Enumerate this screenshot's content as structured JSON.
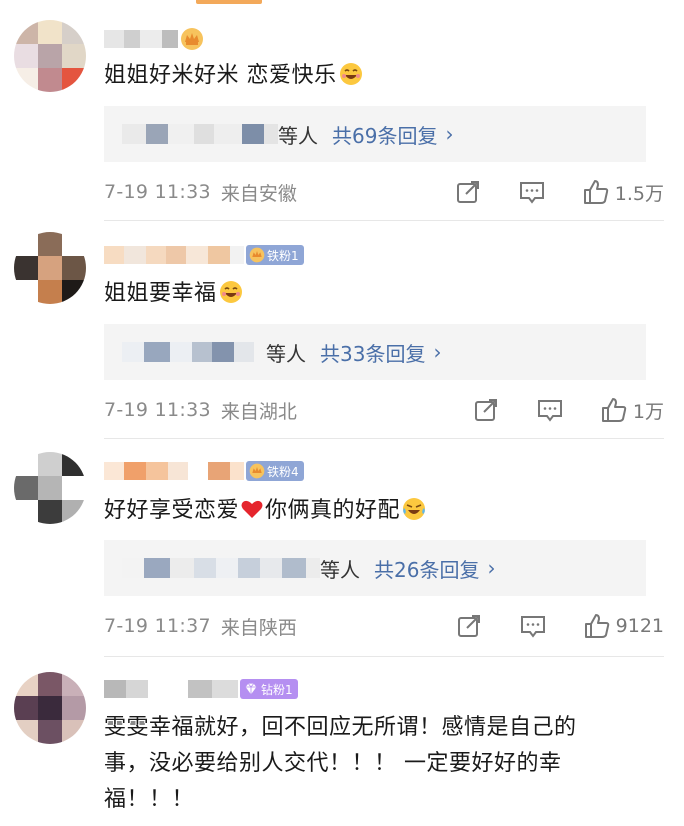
{
  "comments": [
    {
      "text": "姐姐好米好米 恋爱快乐",
      "emoji": "laughing-face-icon",
      "reply_suffix": "等人",
      "reply_link": "共69条回复",
      "date": "7-19 11:33",
      "location": "来自安徽",
      "likes": "1.5万",
      "badge": null
    },
    {
      "text": "姐姐要幸福",
      "emoji": "laughing-face-icon",
      "reply_suffix": "等人",
      "reply_link": "共33条回复",
      "date": "7-19 11:33",
      "location": "来自湖北",
      "likes": "1万",
      "badge": "铁粉1"
    },
    {
      "text": "好好享受恋爱",
      "text2": "你俩真的好配",
      "emoji": "crying-laughing-icon",
      "reply_suffix": "等人",
      "reply_link": "共26条回复",
      "date": "7-19 11:37",
      "location": "来自陕西",
      "likes": "9121",
      "badge": "铁粉4"
    },
    {
      "text_lines": [
        "雯雯幸福就好，回不回应无所谓！感情是自己的",
        "事，没必要给别人交代！！！ 一定要好好的幸",
        "福！！！"
      ],
      "badge": "钻粉1"
    }
  ],
  "colors": {
    "reply_link": "#4a6fa8",
    "iron_badge": "#8fa6d6",
    "diamond_badge": "#b58ff1",
    "reply_box_bg": "#f4f4f4"
  },
  "icons": [
    "share-icon",
    "comment-icon",
    "like-icon",
    "crown-icon",
    "chevron-right-icon"
  ]
}
